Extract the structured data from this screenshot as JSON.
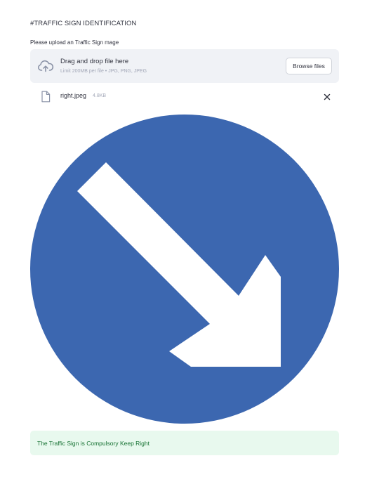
{
  "header": {
    "title": "#TRAFFIC SIGN IDENTIFICATION"
  },
  "uploader": {
    "label": "Please upload an Traffic Sign mage",
    "drop_title": "Drag and drop file here",
    "drop_limit": "Limit 200MB per file • JPG, PNG, JPEG",
    "browse_label": "Browse files",
    "upload_icon": "cloud-upload-icon"
  },
  "uploaded_file": {
    "name": "right.jpeg",
    "size": "4.8KB",
    "file_icon": "file-icon",
    "remove_icon": "close-icon"
  },
  "image": {
    "description": "keep-right-sign",
    "circle_color": "#3c67b0",
    "arrow_color": "#ffffff"
  },
  "result": {
    "text": "The Traffic Sign is Compulsory Keep Right",
    "background_color": "#e8f9ee",
    "text_color": "#177233"
  }
}
